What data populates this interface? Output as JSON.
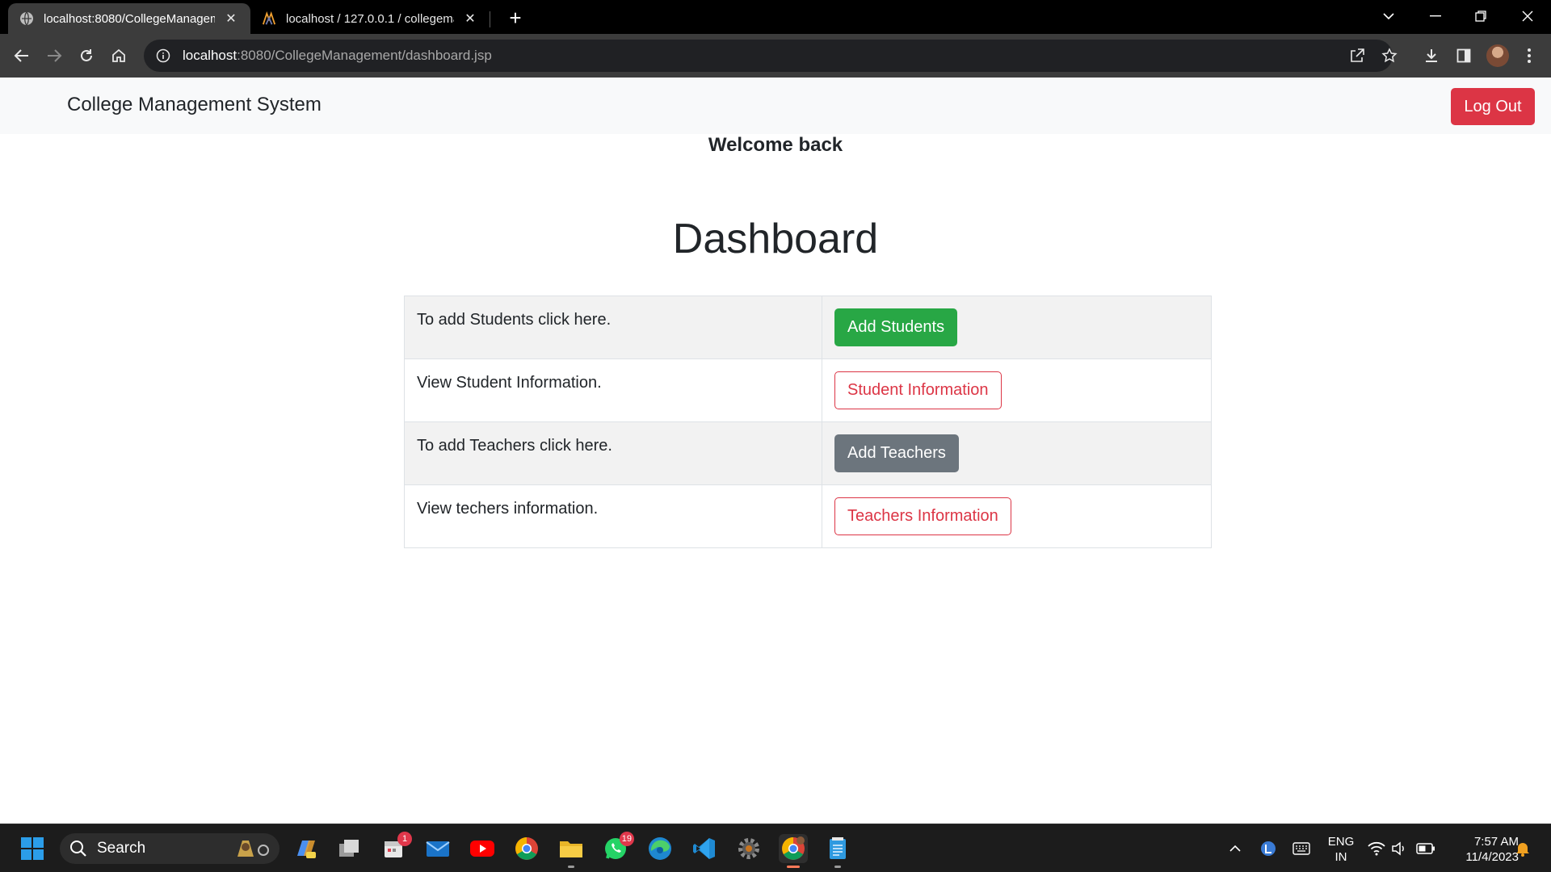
{
  "browser": {
    "tabs": [
      {
        "title": "localhost:8080/CollegeManagem",
        "active": true,
        "favicon": "globe-icon"
      },
      {
        "title": "localhost / 127.0.0.1 / collegema",
        "active": false,
        "favicon": "phpmyadmin-icon"
      }
    ],
    "url_host": "localhost",
    "url_rest": ":8080/CollegeManagement/dashboard.jsp"
  },
  "navbar": {
    "brand": "College Management System",
    "logout_label": "Log Out"
  },
  "main": {
    "welcome": "Welcome back",
    "title": "Dashboard",
    "rows": [
      {
        "text": "To add Students click here.",
        "button": "Add Students",
        "style": "success"
      },
      {
        "text": "View Student Information.",
        "button": "Student Information",
        "style": "outline-danger"
      },
      {
        "text": "To add Teachers click here.",
        "button": "Add Teachers",
        "style": "secondary"
      },
      {
        "text": "View techers information.",
        "button": "Teachers Information",
        "style": "outline-danger"
      }
    ]
  },
  "taskbar": {
    "search_placeholder": "Search",
    "badges": {
      "calendar": "1",
      "whatsapp": "19"
    },
    "language_top": "ENG",
    "language_bottom": "IN",
    "time": "7:57 AM",
    "date": "11/4/2023"
  },
  "colors": {
    "danger": "#dc3545",
    "success": "#28a745",
    "secondary": "#6c757d",
    "navbar_bg": "#f8f9fa"
  }
}
